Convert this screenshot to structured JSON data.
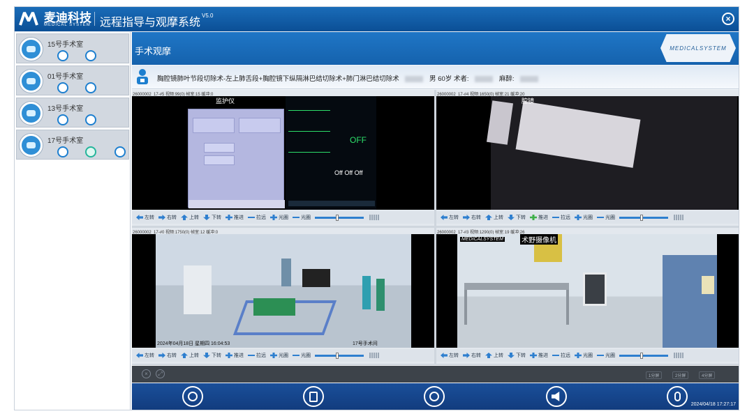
{
  "app": {
    "brand": "麦迪科技",
    "brand_sub": "MEDICAL SYSTEM",
    "title": "远程指导与观摩系统",
    "version": "V5.0"
  },
  "sidebar": {
    "rooms": [
      {
        "name": "15号手术室"
      },
      {
        "name": "01号手术室"
      },
      {
        "name": "13号手术室"
      },
      {
        "name": "17号手术室"
      }
    ]
  },
  "main": {
    "section_title": "手术观摩",
    "badge_text": "MEDICALSYSTEM",
    "patient": {
      "procedure": "胸腔镜肺叶节段切除术-左上肺舌段+胸腔镜下纵隔淋巴结切除术+肺门淋巴结切除术",
      "gender": "男",
      "age": "60岁",
      "surgeon_label": "术者:",
      "anesth_label": "麻醉:"
    }
  },
  "videos": [
    {
      "label": "26000002_17-#5 视频:99(0) 帧室:15 缓冲:0",
      "overlay": "监护仪"
    },
    {
      "label": "26000002_17-#4 视频:1650(0) 帧室:21 缓冲:20",
      "overlay": "腔镜"
    },
    {
      "label": "26000002_17-#0 视频:1750(0) 帧室:12 缓冲:0",
      "overlay": "2024年04月18日 星期四 16:04:53",
      "overlay2": "17号手术间"
    },
    {
      "label": "26000002_17-#3 视频:1290(0) 帧室:19 缓冲:26",
      "overlay": "术野摄像机",
      "overlay_brand": "MEDICALSYSTEM"
    }
  ],
  "controls": {
    "left": "左转",
    "right": "右转",
    "up": "上转",
    "down": "下转",
    "push": "推进",
    "pull": "拉远",
    "open": "光圈",
    "close": "光圈"
  },
  "layout_buttons": [
    "1分屏",
    "2分屏",
    "4分屏"
  ],
  "datetime": "2024/04/18 17:27:17"
}
